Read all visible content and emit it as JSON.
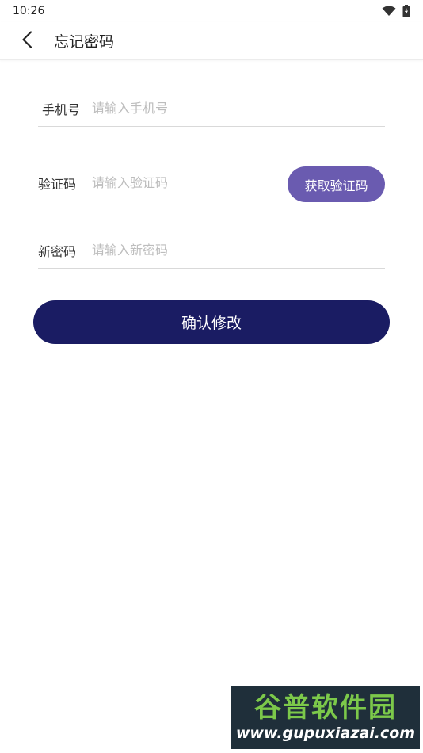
{
  "status_bar": {
    "time": "10:26",
    "icons": [
      "wifi-icon",
      "battery-charging-icon"
    ]
  },
  "app_bar": {
    "back_icon": "chevron-left-icon",
    "title": "忘记密码"
  },
  "form": {
    "phone": {
      "label": "手机号",
      "placeholder": "请输入手机号",
      "value": ""
    },
    "code": {
      "label": "验证码",
      "placeholder": "请输入验证码",
      "value": ""
    },
    "new_password": {
      "label": "新密码",
      "placeholder": "请输入新密码",
      "value": ""
    },
    "get_code_label": "获取验证码",
    "confirm_label": "确认修改"
  },
  "colors": {
    "get_code_button": "#6a5bb0",
    "confirm_button": "#1a1c63",
    "divider": "#d9d9d9",
    "placeholder": "#bdbdbd"
  },
  "watermark": {
    "title": "谷普软件园",
    "url": "www.gupuxiazai.com"
  }
}
